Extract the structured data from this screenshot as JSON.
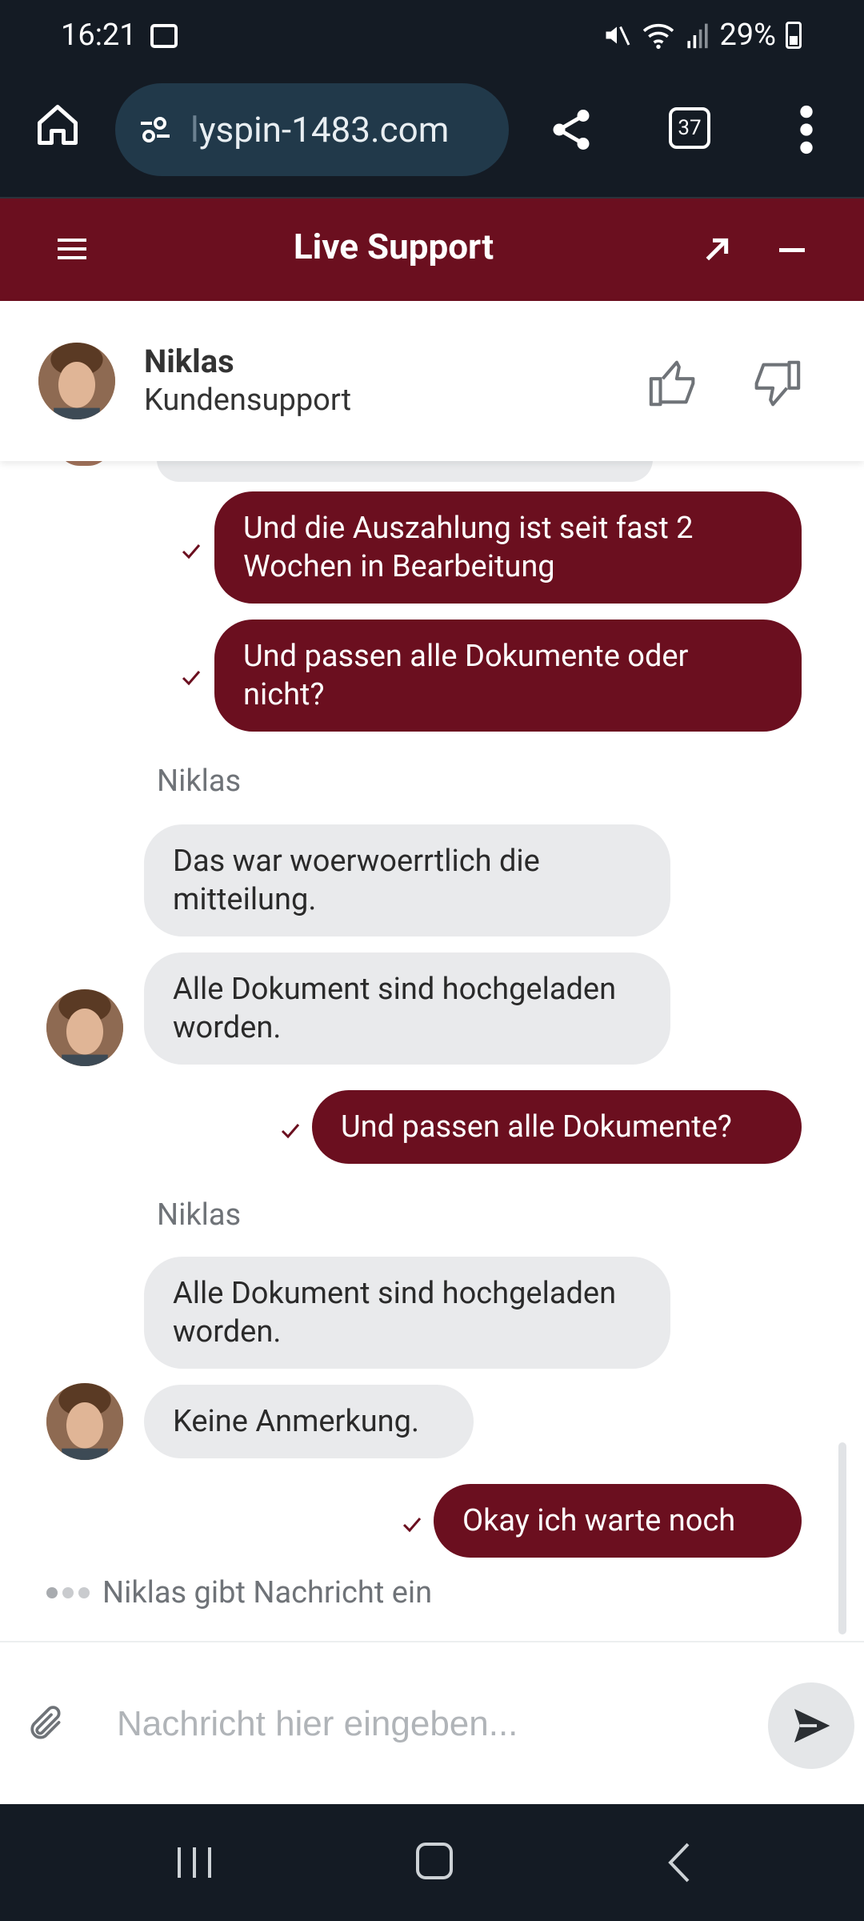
{
  "status_bar": {
    "time": "16:21",
    "battery": "29%"
  },
  "browser": {
    "url_faded": "l",
    "url": "yspin-1483.com",
    "tab_count": "37"
  },
  "support": {
    "title": "Live Support"
  },
  "agent": {
    "name": "Niklas",
    "role": "Kundensupport"
  },
  "messages": [
    {
      "direction": "out",
      "text": "Und die Auszahlung ist seit fast 2 Wochen in Bearbeitung"
    },
    {
      "direction": "out",
      "text": "Und passen alle Dokumente oder nicht?"
    },
    {
      "direction": "sender",
      "text": "Niklas"
    },
    {
      "direction": "in",
      "text": "Das war woerwoerrtlich die mitteilung."
    },
    {
      "direction": "in",
      "text": "Alle Dokument sind hochgeladen worden."
    },
    {
      "direction": "out",
      "text": "Und passen alle Dokumente?"
    },
    {
      "direction": "sender",
      "text": "Niklas"
    },
    {
      "direction": "in",
      "text": "Alle Dokument sind hochgeladen worden."
    },
    {
      "direction": "in",
      "text": "Keine Anmerkung."
    },
    {
      "direction": "out",
      "text": "Okay ich warte noch"
    }
  ],
  "typing_indicator": "Niklas gibt Nachricht ein",
  "input": {
    "placeholder": "Nachricht hier eingeben..."
  },
  "colors": {
    "brand": "#6b0f1f",
    "incoming_bubble": "#e9eaec",
    "system_bar": "#141b24"
  }
}
